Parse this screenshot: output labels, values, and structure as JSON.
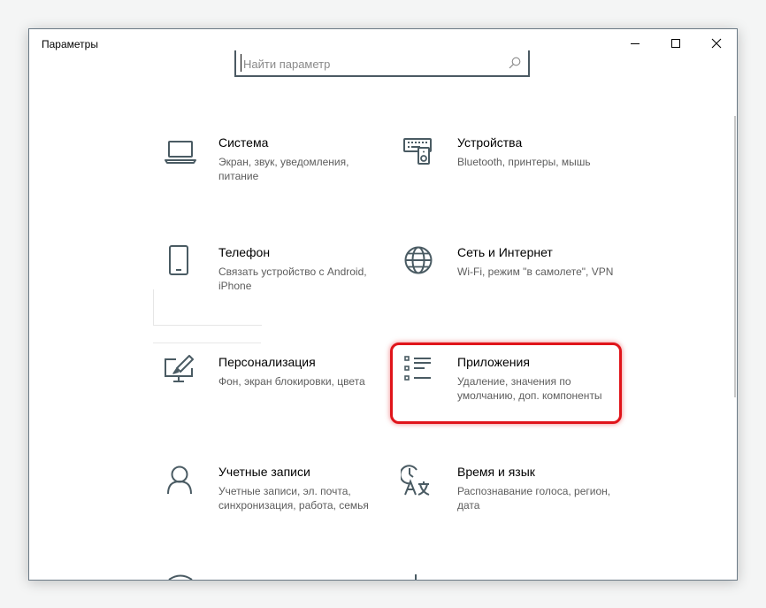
{
  "window": {
    "title": "Параметры"
  },
  "search": {
    "placeholder": "Найти параметр"
  },
  "colors": {
    "icon": "#4a5b63",
    "highlight": "#e0141a"
  },
  "tiles": [
    {
      "name": "Система",
      "desc": "Экран, звук, уведомления, питание",
      "icon": "laptop-icon"
    },
    {
      "name": "Устройства",
      "desc": "Bluetooth, принтеры, мышь",
      "icon": "keyboard-speaker-icon"
    },
    {
      "name": "Телефон",
      "desc": "Связать устройство с Android, iPhone",
      "icon": "phone-icon"
    },
    {
      "name": "Сеть и Интернет",
      "desc": "Wi-Fi, режим \"в самолете\", VPN",
      "icon": "globe-icon"
    },
    {
      "name": "Персонализация",
      "desc": "Фон, экран блокировки, цвета",
      "icon": "paint-monitor-icon"
    },
    {
      "name": "Приложения",
      "desc": "Удаление, значения по умолчанию, доп. компоненты",
      "icon": "apps-list-icon"
    },
    {
      "name": "Учетные записи",
      "desc": "Учетные записи, эл. почта, синхронизация, работа, семья",
      "icon": "person-icon"
    },
    {
      "name": "Время и язык",
      "desc": "Распознавание голоса, регион, дата",
      "icon": "time-language-icon"
    }
  ]
}
